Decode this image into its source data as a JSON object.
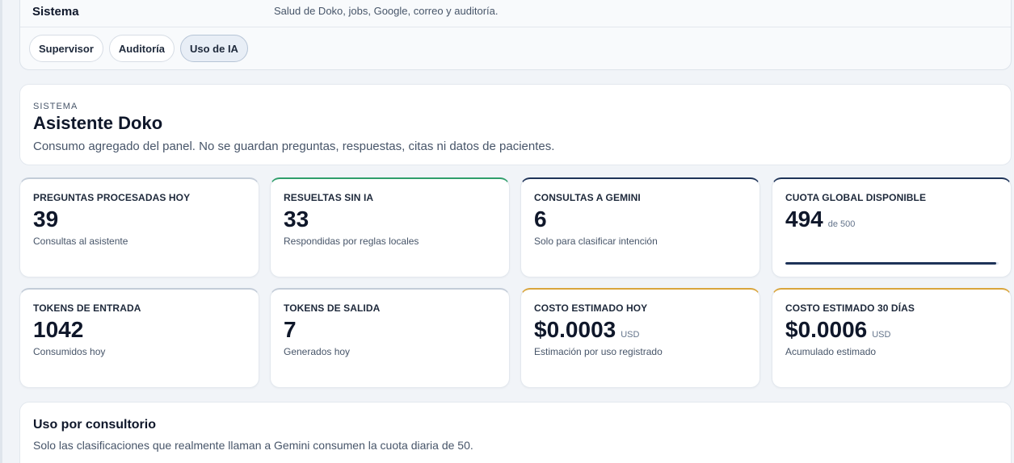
{
  "nav": {
    "title": "Sistema",
    "description": "Salud de Doko, jobs, Google, correo y auditoría.",
    "tabs": [
      {
        "label": "Supervisor",
        "active": false
      },
      {
        "label": "Auditoría",
        "active": false
      },
      {
        "label": "Uso de IA",
        "active": true
      }
    ]
  },
  "header": {
    "eyebrow": "SISTEMA",
    "title": "Asistente Doko",
    "subtitle": "Consumo agregado del panel. No se guardan preguntas, respuestas, citas ni datos de pacientes."
  },
  "stats": [
    {
      "label": "PREGUNTAS PROCESADAS HOY",
      "value": "39",
      "unit": "",
      "sub": "Consultas al asistente",
      "accent": "#c3ccd8"
    },
    {
      "label": "RESUELTAS SIN IA",
      "value": "33",
      "unit": "",
      "sub": "Respondidas por reglas locales",
      "accent": "#2f9e6b"
    },
    {
      "label": "CONSULTAS A GEMINI",
      "value": "6",
      "unit": "",
      "sub": "Solo para clasificar intención",
      "accent": "#1e3358"
    },
    {
      "label": "CUOTA GLOBAL DISPONIBLE",
      "value": "494",
      "unit": "de 500",
      "sub": "",
      "accent": "#1e3358",
      "progress": 0.988
    },
    {
      "label": "TOKENS DE ENTRADA",
      "value": "1042",
      "unit": "",
      "sub": "Consumidos hoy",
      "accent": "#c3ccd8"
    },
    {
      "label": "TOKENS DE SALIDA",
      "value": "7",
      "unit": "",
      "sub": "Generados hoy",
      "accent": "#c3ccd8"
    },
    {
      "label": "COSTO ESTIMADO HOY",
      "value": "$0.0003",
      "unit": "USD",
      "sub": "Estimación por uso registrado",
      "accent": "#d9a53c"
    },
    {
      "label": "COSTO ESTIMADO 30 DÍAS",
      "value": "$0.0006",
      "unit": "USD",
      "sub": "Acumulado estimado",
      "accent": "#d9a53c"
    }
  ],
  "usage": {
    "title": "Uso por consultorio",
    "subtitle": "Solo las clasificaciones que realmente llaman a Gemini consumen la cuota diaria de 50."
  }
}
